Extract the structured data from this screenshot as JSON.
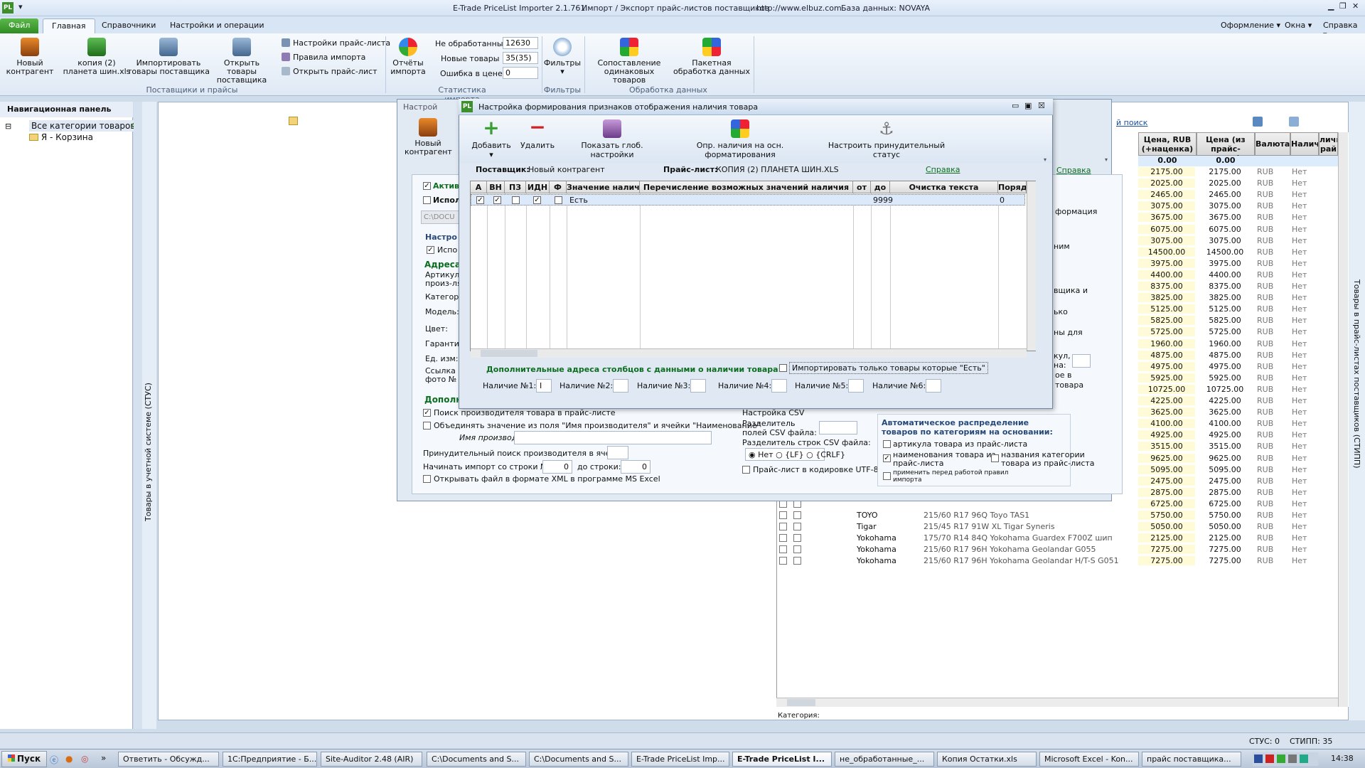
{
  "title": {
    "app": "E-Trade PriceList Importer 2.1.761",
    "module": "Импорт / Экспорт прайс-листов поставщиков",
    "url": "http://www.elbuz.com",
    "db": "База данных: NOVAYA",
    "logo": "PL"
  },
  "ribbon_tabs": [
    "Файл",
    "Главная",
    "Справочники",
    "Настройки и операции"
  ],
  "ribbon_right": {
    "appearance": "Оформление",
    "windows": "Окна",
    "help": "Справка"
  },
  "ribbon": {
    "new_contractor": "Новый\nконтрагент",
    "copy_file": "копия (2)\nпланета шин.xls",
    "import_goods": "Импортировать\nтовары поставщика",
    "open_goods": "Открыть товары\nпоставщика",
    "group1": "Поставщики и прайсы",
    "pl_settings": "Настройки прайс-листа",
    "import_rules": "Правила импорта",
    "open_pl": "Открыть прайс-лист",
    "reports": "Отчёты\nимпорта",
    "not_processed_label": "Не обработанные",
    "not_processed_val": "12630",
    "new_goods_label": "Новые товары",
    "new_goods_val": "35(35)",
    "price_err_label": "Ошибка в цене",
    "price_err_val": "0",
    "group2": "Статистика импорта",
    "filters": "Фильтры",
    "group3": "Фильтры",
    "match": "Сопоставление\nодинаковых товаров",
    "batch": "Пакетная\nобработка данных",
    "group4": "Обработка данных"
  },
  "nav": {
    "header": "Навигационная панель",
    "all": "Все категории товаров",
    "cart": "Я - Корзина",
    "side_label": "Товары в учетной системе (СТУС)"
  },
  "right_side_label": "Товары в прайс-листах поставщиков (СТИПП)",
  "grid": {
    "link": "й поиск",
    "headers": {
      "price_rub": "Цена, RUB\n(+наценка)",
      "price_pl": "Цена (из\nпрайс-листа)",
      "currency": "Валюта",
      "avail": "Наличи",
      "avail2": "личи\nрай"
    },
    "totals": [
      "0.00",
      "0.00"
    ],
    "rows": [
      [
        "2175.00",
        "2175.00"
      ],
      [
        "2025.00",
        "2025.00"
      ],
      [
        "2465.00",
        "2465.00"
      ],
      [
        "3075.00",
        "3075.00"
      ],
      [
        "3675.00",
        "3675.00"
      ],
      [
        "6075.00",
        "6075.00"
      ],
      [
        "3075.00",
        "3075.00"
      ],
      [
        "14500.00",
        "14500.00"
      ],
      [
        "3975.00",
        "3975.00"
      ],
      [
        "4400.00",
        "4400.00"
      ],
      [
        "8375.00",
        "8375.00"
      ],
      [
        "3825.00",
        "3825.00"
      ],
      [
        "5125.00",
        "5125.00"
      ],
      [
        "5825.00",
        "5825.00"
      ],
      [
        "5725.00",
        "5725.00"
      ],
      [
        "1960.00",
        "1960.00"
      ],
      [
        "4875.00",
        "4875.00"
      ],
      [
        "4975.00",
        "4975.00"
      ],
      [
        "5925.00",
        "5925.00"
      ],
      [
        "10725.00",
        "10725.00"
      ],
      [
        "4225.00",
        "4225.00"
      ],
      [
        "3625.00",
        "3625.00"
      ],
      [
        "4100.00",
        "4100.00"
      ],
      [
        "4925.00",
        "4925.00"
      ],
      [
        "3515.00",
        "3515.00"
      ],
      [
        "9625.00",
        "9625.00"
      ],
      [
        "5095.00",
        "5095.00"
      ],
      [
        "2475.00",
        "2475.00"
      ],
      [
        "2875.00",
        "2875.00"
      ],
      [
        "6725.00",
        "6725.00"
      ],
      [
        "5750.00",
        "5750.00"
      ],
      [
        "5050.00",
        "5050.00"
      ],
      [
        "2125.00",
        "2125.00"
      ],
      [
        "7275.00",
        "7275.00"
      ],
      [
        "7275.00",
        "7275.00"
      ]
    ],
    "cur": "RUB",
    "no": "Нет",
    "named_rows": [
      {
        "brand": "TOYO",
        "name": "215/60 R17 96Q Toyo TAS1"
      },
      {
        "brand": "Tigar",
        "name": "215/45 R17 91W XL Tigar Syneris"
      },
      {
        "brand": "Yokohama",
        "name": "175/70 R14 84Q Yokohama Guardex F700Z шип"
      },
      {
        "brand": "Yokohama",
        "name": "215/60 R17 96H Yokohama Geolandar G055"
      },
      {
        "brand": "Yokohama",
        "name": "215/60 R17 96H Yokohama Geolandar H/T-S G051"
      }
    ],
    "category_label": "Категория:"
  },
  "back": {
    "title": "Настрой",
    "new_contractor": "Новый\nконтрагент",
    "active": "Актив",
    "use": "Испол",
    "path": "C:\\DOCU",
    "settings": "Настро",
    "use2": "Испо",
    "address": "Адреса",
    "article": "Артикул\nпроиз-ля",
    "category": "Категор",
    "model": "Модель:",
    "color": "Цвет:",
    "warranty": "Гаранти",
    "unit": "Ед. изм:",
    "photo_link": "Ссылка н\nфото №",
    "extra": "Дополн",
    "search_mfr": "Поиск производителя товара в прайс-листе",
    "combine": "Объединять значение из поля \"Имя производителя\" и ячейки \"Наименование\"",
    "mfr_name": "Имя производителя:",
    "forced_search": "Принудительный поиск производителя в ячейке:",
    "start_row": "Начинать импорт со строки №:",
    "start_row_val": "0",
    "to_row": "до строки:",
    "to_row_val": "0",
    "open_xml": "Открывать файл в формате XML в программе MS Excel",
    "csv": "Настройка CSV",
    "csv_sep_field": "Разделитель\nполей CSV файла:",
    "csv_sep_row": "Разделитель строк CSV файла:",
    "csv_no": "Нет",
    "csv_lf": "{LF}",
    "csv_crlf": "{CRLF}",
    "utf8": "Прайс-лист в кодировке UTF-8",
    "auto_dist": "Автоматическое распределение\nтоваров по категориям на основании:",
    "by_article": "артикула товара из прайс-листа",
    "by_name": "наименования товара из\nпрайс-листа",
    "by_cat_name": "названия  категории\nтовара из прайс-листа",
    "apply_rules": "применить перед работой правил\nимпорта",
    "help": "Справка",
    "info": "формация",
    "right_texts": [
      "ним",
      "вщика и",
      "ько",
      "ны для",
      "кул,",
      "на:",
      "ое в",
      "товара"
    ]
  },
  "dialog": {
    "title": "Настройка формирования признаков отображения наличия товара",
    "add": "Добавить",
    "delete": "Удалить",
    "show_global": "Показать глоб. настройки",
    "det_avail": "Опр. наличия на осн. форматирования",
    "forced_status": "Настроить принудительный статус",
    "supplier_label": "Поставщик:",
    "supplier": "Новый контрагент",
    "pricelist_label": "Прайс-лист:",
    "pricelist": "КОПИЯ (2) ПЛАНЕТА ШИН.XLS",
    "help": "Справка",
    "cols": [
      "А",
      "ВН",
      "ПЗ",
      "ИДН",
      "Ф",
      "Значение налич",
      "Перечисление возможных значений наличия",
      "от",
      "до",
      "Очистка текста",
      "Поряд"
    ],
    "row": {
      "value": "Есть",
      "to": "9999",
      "order": "0"
    },
    "extra_cols": "Дополнительные адреса столбцов с данными о наличии товара:",
    "import_only": "Импортировать только товары которые \"Есть\"",
    "avail": [
      "Наличие №1:",
      "Наличие №2:",
      "Наличие №3:",
      "Наличие №4:",
      "Наличие №5:",
      "Наличие №6:"
    ],
    "avail1_val": "I"
  },
  "status": {
    "stus": "СТУС: 0",
    "stipp": "СТИПП: 35"
  },
  "taskbar": {
    "start": "Пуск",
    "items": [
      "Ответить - Обсужд...",
      "1С:Предприятие - Б...",
      "Site-Auditor 2.48 (AIR)",
      "C:\\Documents and S...",
      "C:\\Documents and S...",
      "E-Trade PriceList Imp...",
      "E-Trade PriceList I...",
      "не_обработанные_...",
      "Копия Остатки.xls",
      "Microsoft Excel - Kon...",
      "прайс поставщика..."
    ],
    "clock": "14:38"
  }
}
